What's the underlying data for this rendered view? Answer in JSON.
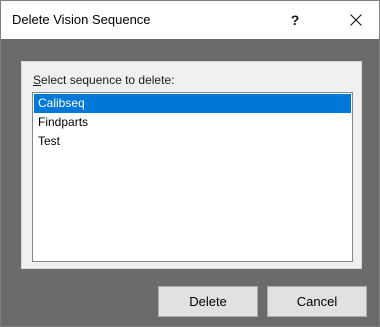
{
  "window": {
    "title": "Delete Vision Sequence",
    "help_label": "?",
    "close_icon": "close-icon"
  },
  "group": {
    "label_mnemonic": "S",
    "label_rest": "elect sequence to delete:"
  },
  "list": {
    "items": [
      "Calibseq",
      "Findparts",
      "Test"
    ],
    "selected_index": 0
  },
  "buttons": {
    "delete_label": "Delete",
    "cancel_label": "Cancel"
  },
  "colors": {
    "selection": "#0078d7",
    "dialog_background": "#6b6b6b",
    "group_background": "#f0f0f0",
    "button_face": "#e1e1e1"
  }
}
